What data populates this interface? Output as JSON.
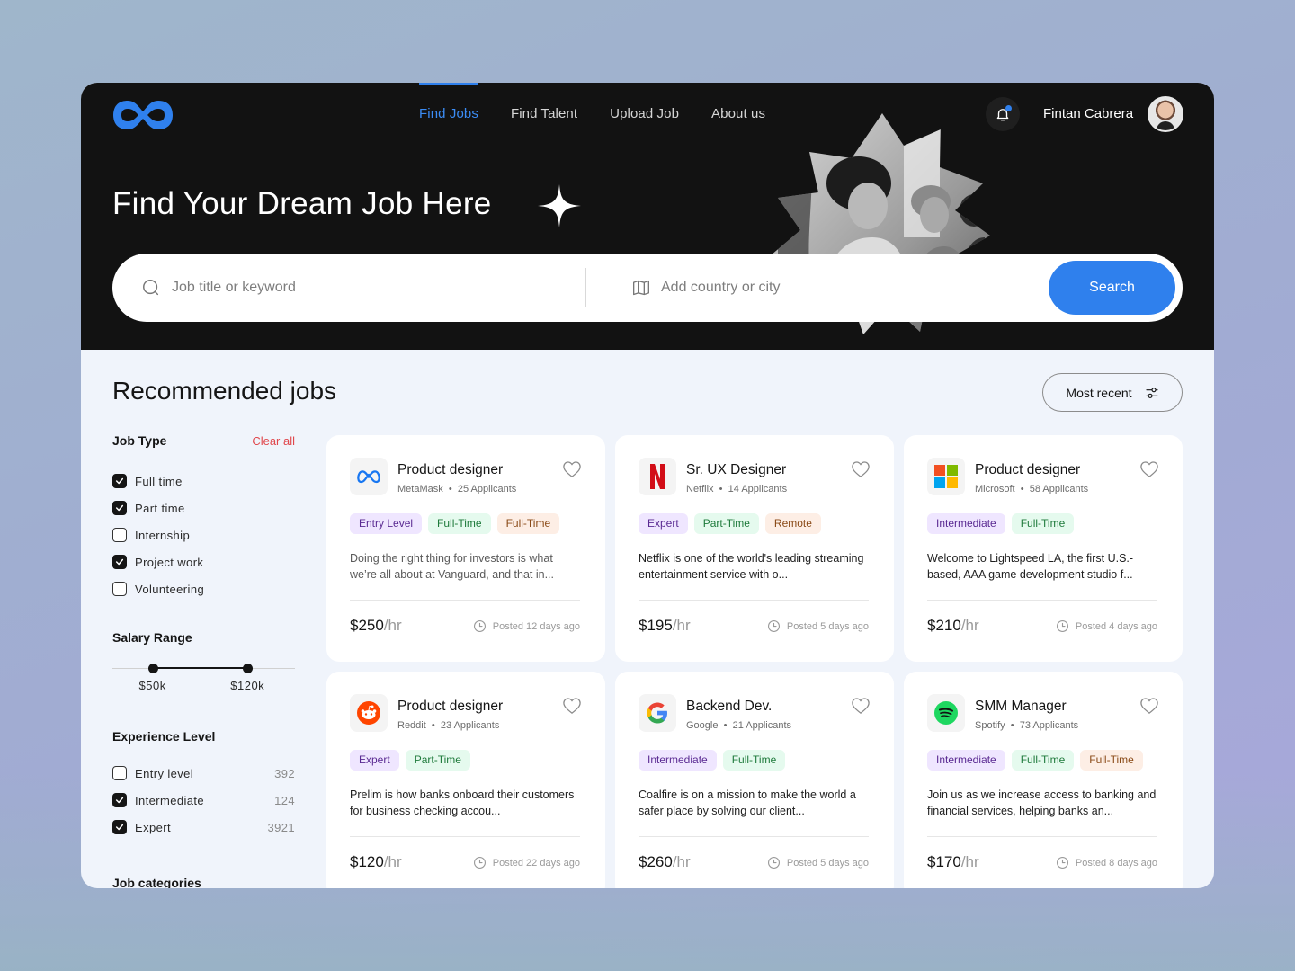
{
  "nav": {
    "items": [
      {
        "label": "Find Jobs",
        "active": true
      },
      {
        "label": "Find Talent",
        "active": false
      },
      {
        "label": "Upload Job",
        "active": false
      },
      {
        "label": "About us",
        "active": false
      }
    ]
  },
  "user": {
    "name": "Fintan Cabrera",
    "has_notification": true
  },
  "hero": {
    "title": "Find Your Dream Job Here"
  },
  "search": {
    "keyword_placeholder": "Job title or keyword",
    "keyword_value": "",
    "location_placeholder": "Add country or city",
    "location_value": "",
    "button_label": "Search"
  },
  "main": {
    "title": "Recommended jobs",
    "sort_label": "Most recent"
  },
  "filters": {
    "job_type": {
      "heading": "Job Type",
      "clear_label": "Clear all",
      "options": [
        {
          "label": "Full time",
          "checked": true
        },
        {
          "label": "Part time",
          "checked": true
        },
        {
          "label": "Internship",
          "checked": false
        },
        {
          "label": "Project work",
          "checked": true
        },
        {
          "label": "Volunteering",
          "checked": false
        }
      ]
    },
    "salary": {
      "heading": "Salary Range",
      "min_label": "$50k",
      "max_label": "$120k",
      "min_fraction": 0.22,
      "max_fraction": 0.74
    },
    "experience": {
      "heading": "Experience Level",
      "options": [
        {
          "label": "Entry level",
          "count": "392",
          "checked": false
        },
        {
          "label": "Intermediate",
          "count": "124",
          "checked": true
        },
        {
          "label": "Expert",
          "count": "3921",
          "checked": true
        }
      ]
    },
    "categories": {
      "heading": "Job categories"
    }
  },
  "colors": {
    "accent": "#2f80ed",
    "danger": "#e0474c",
    "dark": "#121212"
  },
  "jobs": [
    {
      "title": "Product designer",
      "company": "MetaMask",
      "applicants": "25 Applicants",
      "logo": "meta-logo",
      "tags": [
        {
          "label": "Entry Level",
          "color": "purple"
        },
        {
          "label": "Full-Time",
          "color": "green"
        },
        {
          "label": "Full-Time",
          "color": "orange"
        }
      ],
      "description": "Doing the right thing for investors is what we’re all about at Vanguard, and that in...",
      "rate": "$250",
      "unit": "/hr",
      "posted": "Posted 12 days ago"
    },
    {
      "title": "Sr. UX Designer",
      "company": "Netflix",
      "applicants": "14 Applicants",
      "logo": "netflix-logo",
      "tags": [
        {
          "label": "Expert",
          "color": "purple"
        },
        {
          "label": "Part-Time",
          "color": "green"
        },
        {
          "label": "Remote",
          "color": "orange"
        }
      ],
      "description": "Netflix is one of the world's leading streaming entertainment service with o...",
      "rate": "$195",
      "unit": "/hr",
      "posted": "Posted 5 days ago"
    },
    {
      "title": "Product designer",
      "company": "Microsoft",
      "applicants": "58 Applicants",
      "logo": "microsoft-logo",
      "tags": [
        {
          "label": "Intermediate",
          "color": "purple"
        },
        {
          "label": "Full-Time",
          "color": "green"
        }
      ],
      "description": "Welcome to Lightspeed LA, the first U.S.-based, AAA game development studio f...",
      "rate": "$210",
      "unit": "/hr",
      "posted": "Posted 4 days ago"
    },
    {
      "title": "Product designer",
      "company": "Reddit",
      "applicants": "23 Applicants",
      "logo": "reddit-logo",
      "tags": [
        {
          "label": "Expert",
          "color": "purple"
        },
        {
          "label": "Part-Time",
          "color": "green"
        }
      ],
      "description": "Prelim is how banks onboard their customers for business checking accou...",
      "rate": "$120",
      "unit": "/hr",
      "posted": "Posted 22 days ago"
    },
    {
      "title": "Backend Dev.",
      "company": "Google",
      "applicants": "21 Applicants",
      "logo": "google-logo",
      "tags": [
        {
          "label": "Intermediate",
          "color": "purple"
        },
        {
          "label": "Full-Time",
          "color": "green"
        }
      ],
      "description": "Coalfire is on a mission to make the world a safer place by solving our client...",
      "rate": "$260",
      "unit": "/hr",
      "posted": "Posted 5 days ago"
    },
    {
      "title": "SMM Manager",
      "company": "Spotify",
      "applicants": "73 Applicants",
      "logo": "spotify-logo",
      "tags": [
        {
          "label": "Intermediate",
          "color": "purple"
        },
        {
          "label": "Full-Time",
          "color": "green"
        },
        {
          "label": "Full-Time",
          "color": "orange"
        }
      ],
      "description": "Join us as we increase access to banking and financial services, helping banks an...",
      "rate": "$170",
      "unit": "/hr",
      "posted": "Posted 8 days ago"
    }
  ]
}
